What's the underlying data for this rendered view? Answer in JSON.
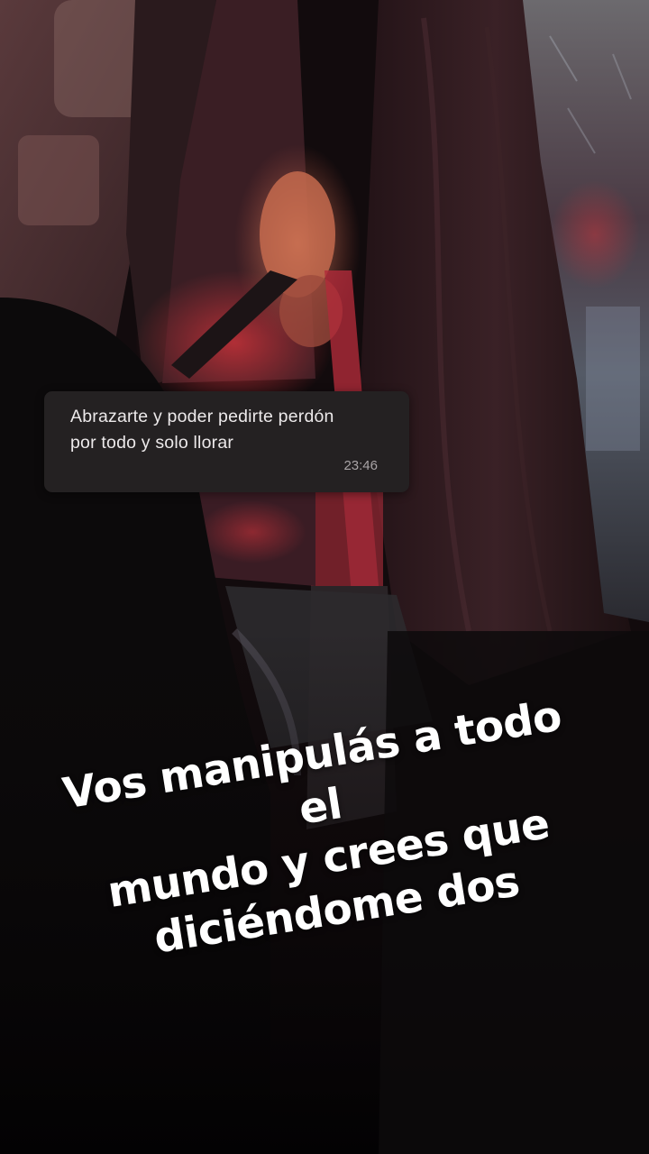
{
  "message": {
    "lines": [
      "Abrazarte y poder pedirte perdón",
      "por todo y solo llorar"
    ],
    "time": "23:46"
  },
  "caption": {
    "lines": [
      "Vos manipulás a todo el",
      "mundo y crees que",
      "diciéndome dos"
    ]
  },
  "colors": {
    "bubble_background": "#242122",
    "bubble_text": "#ece9ea",
    "caption_text": "#ffffff",
    "accent_red": "#c0283c"
  }
}
